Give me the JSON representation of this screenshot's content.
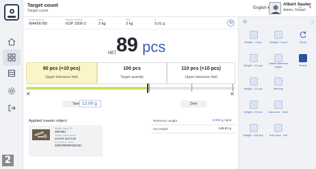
{
  "header": {
    "title": "Target count",
    "subtitle": "Target count",
    "language": "English",
    "user_name": "Albert Sauter",
    "user_role": "Admin, Default"
  },
  "info": [
    {
      "key": "Scale serial no.",
      "value": "WA456789"
    },
    {
      "key": "Weight capacity",
      "value": "KDP 2000-2"
    },
    {
      "key": "Max",
      "value": "3 kg"
    },
    {
      "key": "Min",
      "value": "3 kg"
    },
    {
      "key": "d",
      "value": "0.01 g"
    }
  ],
  "weight": {
    "label": "NET",
    "value": "89",
    "unit": "pcs"
  },
  "tolerance": [
    {
      "value": "90 pcs (+10 pcs)",
      "label": "Upper tolerance limit",
      "active": true
    },
    {
      "value": "100 pcs",
      "label": "Target quantity",
      "active": false
    },
    {
      "value": "110 pcs (+10 pcs)",
      "label": "Upper tolerance limit",
      "active": false
    }
  ],
  "progress": {
    "green_fraction": 0.59
  },
  "tare": {
    "button": "Tare",
    "value": "12.00 g"
  },
  "zero": {
    "button": "Zero"
  },
  "master": {
    "title": "Applied master object",
    "fields": [
      {
        "key": "Master object ID",
        "value": "4567891"
      },
      {
        "key": "Master object name",
        "value": "Screws and nuts"
      },
      {
        "key": "ID number / name",
        "value": "34567890987654321"
      }
    ]
  },
  "reference": [
    {
      "key": "Reference weight",
      "value_prefix": "",
      "value": "3.000 g",
      "suffix": " / pcs"
    },
    {
      "key": "Net weight",
      "value_prefix": "",
      "value": "148.84 g",
      "suffix": ""
    }
  ],
  "panel": {
    "top_icons": [
      "settings-icon",
      "info-icon"
    ],
    "buttons": [
      {
        "label": "Weight = 3 pcs",
        "col": 0,
        "row": 0
      },
      {
        "label": "Weight = N pcs",
        "col": 1,
        "row": 0
      },
      {
        "label": "Reset",
        "col": 2,
        "row": 0
      },
      {
        "label": "Weight = 10 pcs",
        "col": 0,
        "row": 1
      },
      {
        "label": "Define reference weight",
        "col": 1,
        "row": 1
      },
      {
        "label": "Result",
        "col": 2,
        "row": 1
      },
      {
        "label": "Weight = 20 pcs",
        "col": 0,
        "row": 2
      },
      {
        "label": "Memory",
        "col": 1,
        "row": 2
      },
      {
        "label": "Weight = 50 pcs",
        "col": 0,
        "row": 3
      },
      {
        "label": "Auto save - Samt",
        "col": 1,
        "row": 3
      },
      {
        "label": "Weight = 100 pcs",
        "col": 0,
        "row": 4
      },
      {
        "label": "Auto save - Full",
        "col": 1,
        "row": 4
      }
    ]
  },
  "step_badge": "2",
  "colors": {
    "accent": "#3d5eb8",
    "tolerance_active_bg": "#fbf4c8",
    "progress_green": "#c5e35b"
  }
}
